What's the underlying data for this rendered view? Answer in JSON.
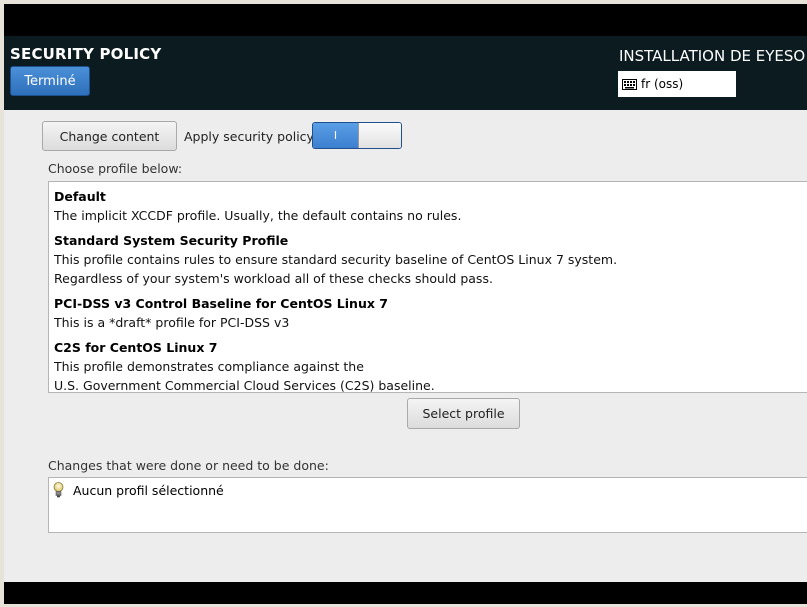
{
  "header": {
    "title": "SECURITY POLICY",
    "done_label": "Terminé",
    "install_title": "INSTALLATION DE EYESO",
    "keyboard_layout": "fr (oss)",
    "keyboard_icon": "keyboard-icon",
    "colors": {
      "background": "#0b1b1f",
      "done_button": "#3f80cc"
    }
  },
  "toolbar": {
    "change_content_label": "Change content",
    "apply_policy_label": "Apply security policy:",
    "apply_policy_toggle_text": "I",
    "apply_policy_enabled": true
  },
  "profiles": {
    "label": "Choose profile below:",
    "items": [
      {
        "title": "Default",
        "desc": [
          "The implicit XCCDF profile. Usually, the default contains no rules."
        ]
      },
      {
        "title": "Standard System Security Profile",
        "desc": [
          "This profile contains rules to ensure standard security baseline of CentOS Linux 7 system.",
          "Regardless of your system's workload all of these checks should pass."
        ]
      },
      {
        "title": "PCI-DSS v3 Control Baseline for CentOS Linux 7",
        "desc": [
          "This is a *draft* profile for PCI-DSS v3"
        ]
      },
      {
        "title": "C2S for CentOS Linux 7",
        "desc": [
          "This profile demonstrates compliance against the",
          "U.S. Government Commercial Cloud Services (C2S) baseline."
        ]
      }
    ],
    "select_label": "Select profile"
  },
  "changes": {
    "label": "Changes that were done or need to be done:",
    "message": "Aucun profil sélectionné",
    "icon": "lightbulb-icon"
  }
}
